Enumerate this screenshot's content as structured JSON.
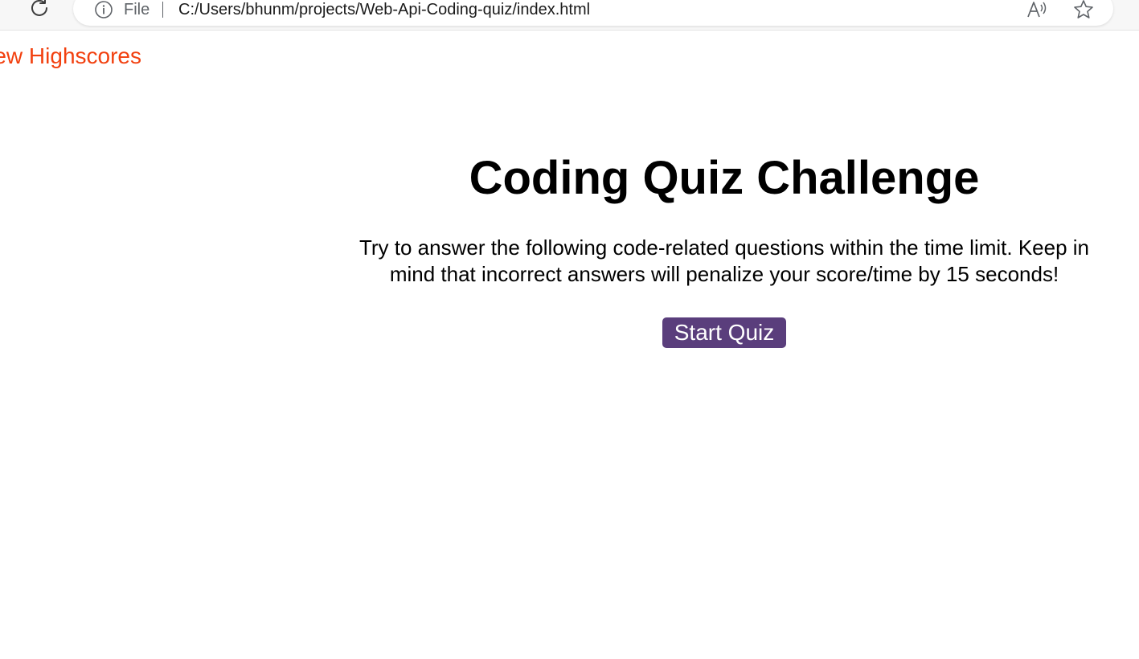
{
  "browser": {
    "file_label": "File",
    "url": "C:/Users/bhunm/projects/Web-Api-Coding-quiz/index.html"
  },
  "header": {
    "highscores_link": "View Highscores"
  },
  "main": {
    "title": "Coding Quiz Challenge",
    "intro": "Try to answer the following code-related questions within the time limit. Keep in mind that incorrect answers will penalize your score/time by 15 seconds!",
    "start_button": "Start Quiz"
  },
  "icons": {
    "reload": "reload-icon",
    "info": "info-icon",
    "read_aloud": "read-aloud-icon",
    "favorite": "favorite-star-icon"
  },
  "colors": {
    "link": "#f2400f",
    "button_bg": "#5a3e7c",
    "button_text": "#ffffff"
  }
}
